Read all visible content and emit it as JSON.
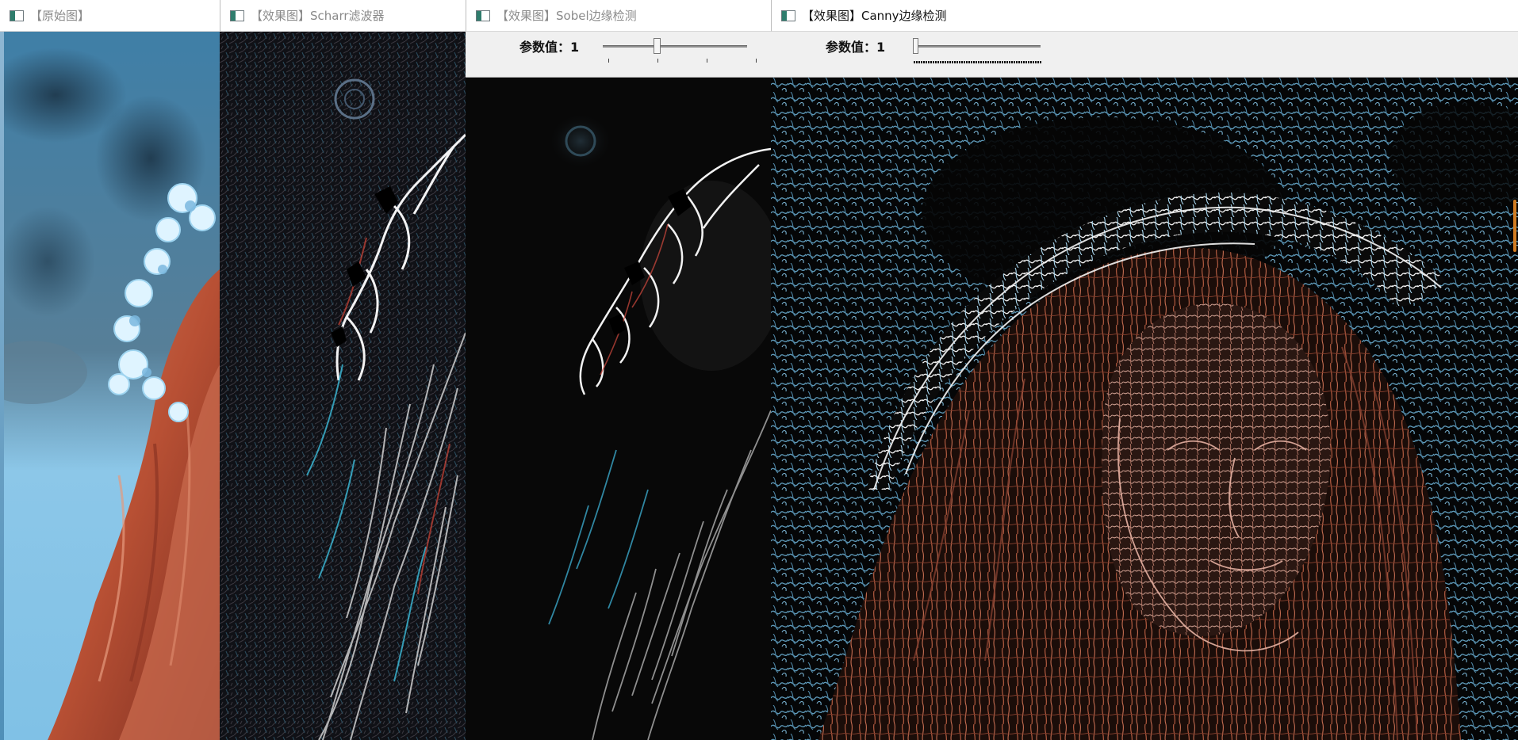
{
  "windows": [
    {
      "title": "【原始图】",
      "icon": "opencv-window-icon"
    },
    {
      "title": "【效果图】Scharr滤波器",
      "icon": "opencv-window-icon"
    },
    {
      "title": "【效果图】Sobel边缘检测",
      "icon": "opencv-window-icon",
      "trackbar": {
        "label": "参数值：1",
        "value": 1
      }
    },
    {
      "title": "【效果图】Canny边缘检测",
      "icon": "opencv-window-icon",
      "trackbar": {
        "label": "参数值：1",
        "value": 1
      }
    }
  ],
  "colors": {
    "titlebar_background": "#ffffff",
    "toolbar_background": "#f0f0f0",
    "edge_background": "#000000",
    "hair_tone": "#b0553c",
    "sky_tone": "#7cc0e6",
    "scrollbar_accent": "#d27c21"
  }
}
